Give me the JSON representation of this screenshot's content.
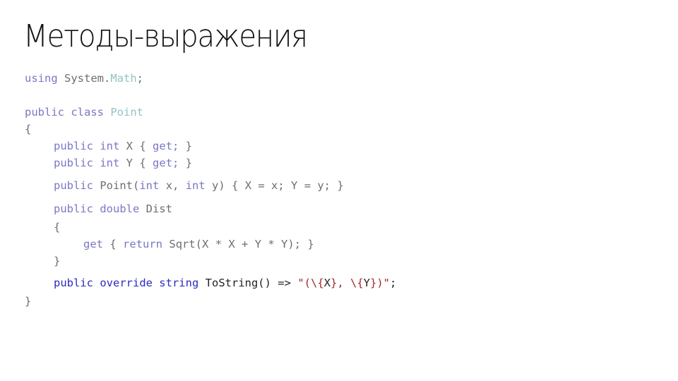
{
  "title": "Методы-выражения",
  "code": {
    "line1": {
      "kw": "using",
      "ns": "System.",
      "type": "Math",
      "end": ";"
    },
    "line2": {
      "kw": "public class",
      "type": "Point"
    },
    "line3": {
      "text": "{"
    },
    "line4": {
      "kw": "public int",
      "name": "X",
      "open": "{",
      "get": "get;",
      "close": "}"
    },
    "line5": {
      "kw": "public int",
      "name": "Y",
      "open": "{",
      "get": "get;",
      "close": "}"
    },
    "line6": {
      "kw": "public",
      "ctor": "Point(",
      "kw2": "int",
      "p1": "x,",
      "kw3": "int",
      "p2": "y) { X = x; Y = y; }"
    },
    "line7": {
      "kw": "public double",
      "name": "Dist"
    },
    "line8": {
      "text": "{"
    },
    "line9": {
      "kw": "get",
      "open": "{",
      "kw2": "return",
      "expr": "Sqrt(X * X + Y * Y); }"
    },
    "line10": {
      "text": "}"
    },
    "line11": {
      "kw": "public override string",
      "name": "ToString() =>",
      "s1": "\"(\\{",
      "i1": "X",
      "s2": "}, \\{",
      "i2": "Y",
      "s3": "})\"",
      "end": ";"
    },
    "line12": {
      "text": "}"
    }
  }
}
